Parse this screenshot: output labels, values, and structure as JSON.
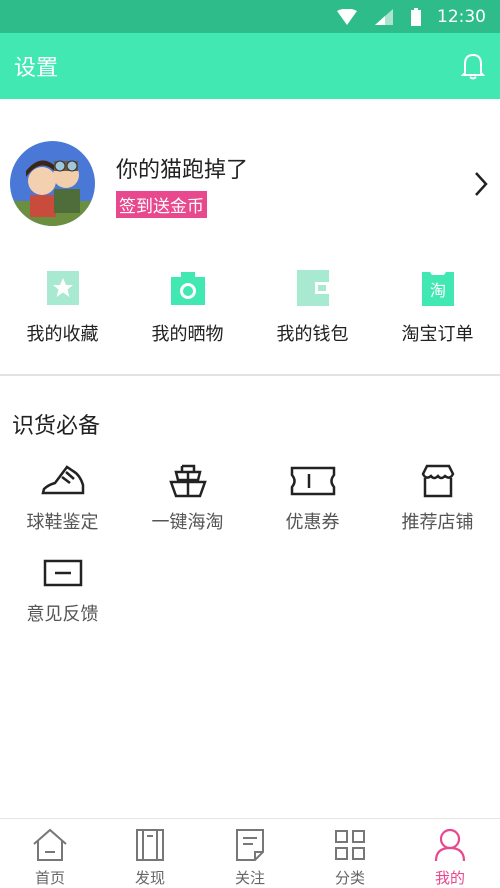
{
  "status_bar": {
    "time": "12:30"
  },
  "header": {
    "title": "设置",
    "notification_icon": "bell-icon"
  },
  "profile": {
    "name": "你的猫跑掉了",
    "checkin_label": "签到送金币"
  },
  "quick_actions": [
    {
      "label": "我的收藏",
      "icon": "star-icon"
    },
    {
      "label": "我的晒物",
      "icon": "camera-icon"
    },
    {
      "label": "我的钱包",
      "icon": "wallet-icon"
    },
    {
      "label": "淘宝订单",
      "icon": "taobao-icon",
      "glyph": "淘"
    }
  ],
  "section": {
    "title": "识货必备"
  },
  "tools": [
    {
      "label": "球鞋鉴定",
      "icon": "sneaker-icon"
    },
    {
      "label": "一键海淘",
      "icon": "ship-icon"
    },
    {
      "label": "优惠券",
      "icon": "coupon-icon"
    },
    {
      "label": "推荐店铺",
      "icon": "store-icon"
    },
    {
      "label": "意见反馈",
      "icon": "feedback-icon"
    }
  ],
  "tabbar": {
    "active": "我的",
    "items": [
      {
        "label": "首页",
        "icon": "home-icon"
      },
      {
        "label": "发现",
        "icon": "discover-icon"
      },
      {
        "label": "关注",
        "icon": "follow-icon"
      },
      {
        "label": "分类",
        "icon": "category-icon"
      },
      {
        "label": "我的",
        "icon": "profile-icon"
      }
    ]
  },
  "colors": {
    "status_bar": "#2ebd8a",
    "accent": "#41e8b1",
    "pink": "#e8488e"
  }
}
